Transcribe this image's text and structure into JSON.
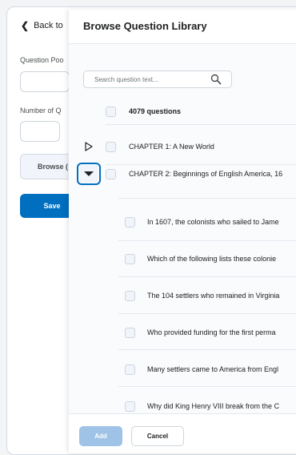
{
  "background_page": {
    "back_label": "Back to",
    "question_pool_label": "Question Poo",
    "number_label": "Number of Q",
    "browse_button": "Browse (",
    "save_button": "Save"
  },
  "dialog": {
    "title": "Browse Question Library",
    "search_placeholder": "Search question text...",
    "select_all_label": "4079 questions",
    "chapters": [
      {
        "label": "CHAPTER 1: A New World",
        "expanded": false
      },
      {
        "label": "CHAPTER 2: Beginnings of English America, 16",
        "expanded": true
      }
    ],
    "questions": [
      "In 1607, the colonists who sailed to Jame",
      "Which of the following lists these colonie",
      "The 104 settlers who remained in Virginia",
      "Who provided funding for the first perma",
      "Many settlers came to America from Engl",
      "Why did King Henry VIII break from the C"
    ],
    "add_button": "Add",
    "cancel_button": "Cancel"
  },
  "colors": {
    "primary": "#006fbf",
    "primary_disabled": "#9ec3e6",
    "border": "#cdd5dc"
  }
}
